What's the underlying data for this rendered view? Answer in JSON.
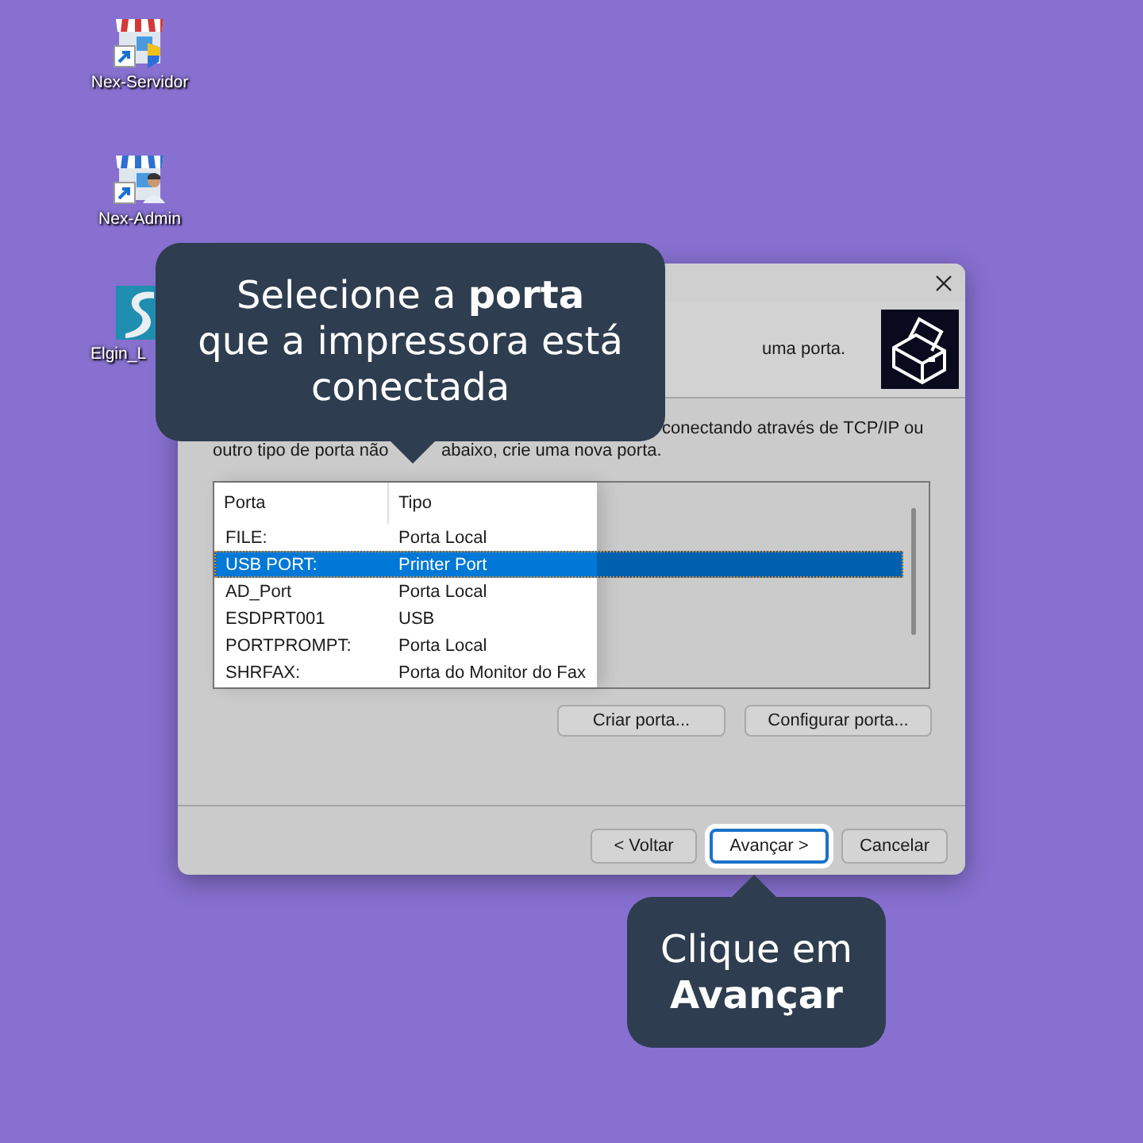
{
  "desktop_icons": [
    {
      "label": "Nex-Servidor",
      "kind": "store"
    },
    {
      "label": "Nex-Admin",
      "kind": "store-admin"
    },
    {
      "label": "Elgin_L",
      "kind": "app"
    }
  ],
  "dialog": {
    "header_text": "uma porta.",
    "description": [
      {
        "text": "conectando através de TCP/IP ou"
      },
      {
        "text": "outro tipo de porta não"
      },
      {
        "text": "abaixo, crie uma nova porta."
      }
    ],
    "port_list": {
      "columns": [
        "Porta",
        "Tipo"
      ],
      "rows": [
        {
          "porta": "FILE:",
          "tipo": "Porta Local",
          "selected": false
        },
        {
          "porta": "USB PORT:",
          "tipo": "Printer Port",
          "selected": true
        },
        {
          "porta": "AD_Port",
          "tipo": "Porta Local",
          "selected": false
        },
        {
          "porta": "ESDPRT001",
          "tipo": "USB",
          "selected": false
        },
        {
          "porta": "PORTPROMPT:",
          "tipo": "Porta Local",
          "selected": false
        },
        {
          "porta": "SHRFAX:",
          "tipo": "Porta do Monitor do Fax",
          "selected": false
        }
      ]
    },
    "list_buttons": [
      "Criar porta...",
      "Configurar porta..."
    ],
    "footer_buttons": [
      {
        "label": "< Voltar",
        "focused": false
      },
      {
        "label": "Avançar >",
        "focused": true
      },
      {
        "label": "Cancelar",
        "focused": false
      }
    ]
  },
  "callouts": [
    {
      "text": "Selecione a **porta**\nque a impressora está\nconectada",
      "kind": "pointer-down"
    },
    {
      "text": "Clique em\n**Avançar**",
      "kind": "pointer-up"
    }
  ]
}
